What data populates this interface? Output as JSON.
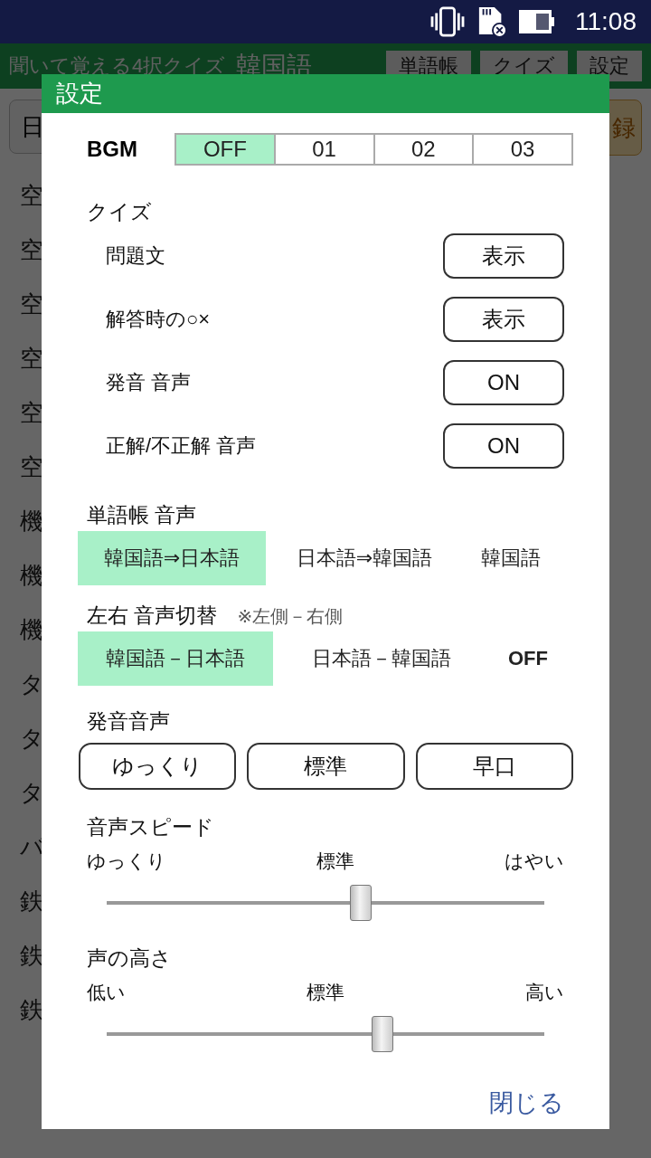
{
  "status_bar": {
    "time": "11:08"
  },
  "app": {
    "title": "聞いて覚える4択クイズ",
    "language": "韓国語",
    "tabs": [
      "単語帳",
      "クイズ",
      "設定"
    ],
    "field_value": "日",
    "button": "録",
    "list": [
      "空",
      "空",
      "空",
      "空",
      "空",
      "空",
      "機",
      "機",
      "機",
      "タ",
      "タ",
      "タ",
      "バ",
      "鉄",
      "鉄",
      "鉄"
    ]
  },
  "dialog": {
    "title": "設定",
    "bgm": {
      "label": "BGM",
      "options": [
        {
          "label": "OFF",
          "selected": true
        },
        {
          "label": "01",
          "selected": false
        },
        {
          "label": "02",
          "selected": false
        },
        {
          "label": "03",
          "selected": false
        }
      ]
    },
    "quiz": {
      "heading": "クイズ",
      "rows": [
        {
          "label": "問題文",
          "button": "表示"
        },
        {
          "label": "解答時の○×",
          "button": "表示"
        },
        {
          "label": "発音 音声",
          "button": "ON"
        },
        {
          "label": "正解/不正解 音声",
          "button": "ON"
        }
      ]
    },
    "wordbook_audio": {
      "heading": "単語帳 音声",
      "options": [
        {
          "label": "韓国語⇒日本語",
          "selected": true
        },
        {
          "label": "日本語⇒韓国語",
          "selected": false
        },
        {
          "label": "韓国語",
          "selected": false
        }
      ]
    },
    "lr_switch": {
      "heading": "左右 音声切替",
      "note": "※左側－右側",
      "options": [
        {
          "label": "韓国語－日本語",
          "selected": true
        },
        {
          "label": "日本語－韓国語",
          "selected": false
        },
        {
          "label": "OFF",
          "selected": false
        }
      ]
    },
    "voice": {
      "heading": "発音音声",
      "options": [
        "ゆっくり",
        "標準",
        "早口"
      ]
    },
    "sliders": [
      {
        "heading": "音声スピード",
        "min_label": "ゆっくり",
        "mid_label": "標準",
        "max_label": "はやい",
        "level": 0.58
      },
      {
        "heading": "声の高さ",
        "min_label": "低い",
        "mid_label": "標準",
        "max_label": "高い",
        "level": 0.63
      }
    ],
    "close": "閉じる"
  }
}
